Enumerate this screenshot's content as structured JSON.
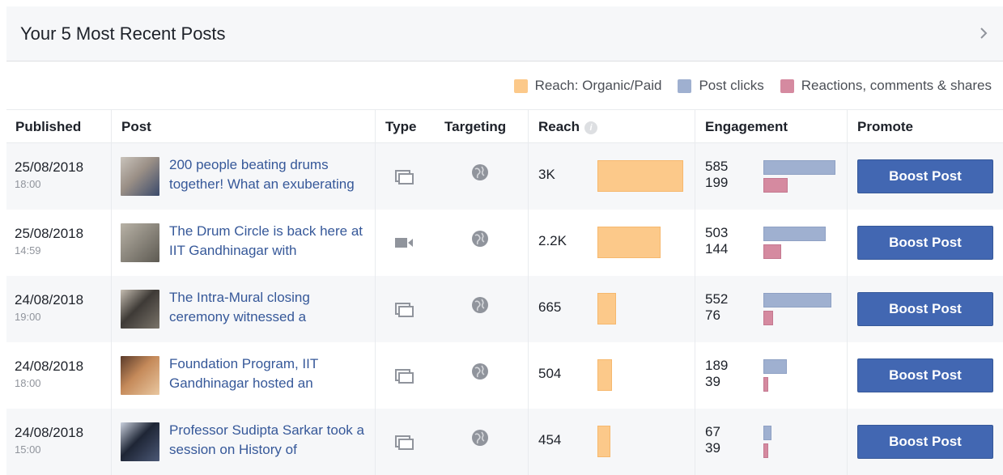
{
  "header": {
    "title": "Your 5 Most Recent Posts"
  },
  "legend": [
    {
      "label": "Reach: Organic/Paid",
      "color": "#fcc98a"
    },
    {
      "label": "Post clicks",
      "color": "#9fb0d0"
    },
    {
      "label": "Reactions, comments & shares",
      "color": "#d58aa0"
    }
  ],
  "columns": {
    "published": "Published",
    "post": "Post",
    "type": "Type",
    "targeting": "Targeting",
    "reach": "Reach",
    "engagement": "Engagement",
    "promote": "Promote"
  },
  "reach_max": 3000,
  "engagement_max": 585,
  "rows": [
    {
      "date": "25/08/2018",
      "time": "18:00",
      "text": "200 people beating drums together! What an exuberating",
      "type": "album",
      "reach_label": "3K",
      "reach_value": 3000,
      "clicks": "585",
      "reactions": "199",
      "clicks_value": 585,
      "reactions_value": 199,
      "boost": "Boost Post"
    },
    {
      "date": "25/08/2018",
      "time": "14:59",
      "text": "The Drum Circle is back here at IIT Gandhinagar with",
      "type": "video",
      "reach_label": "2.2K",
      "reach_value": 2200,
      "clicks": "503",
      "reactions": "144",
      "clicks_value": 503,
      "reactions_value": 144,
      "boost": "Boost Post"
    },
    {
      "date": "24/08/2018",
      "time": "19:00",
      "text": "The Intra-Mural closing ceremony witnessed a",
      "type": "album",
      "reach_label": "665",
      "reach_value": 665,
      "clicks": "552",
      "reactions": "76",
      "clicks_value": 552,
      "reactions_value": 76,
      "boost": "Boost Post"
    },
    {
      "date": "24/08/2018",
      "time": "18:00",
      "text": "Foundation Program, IIT Gandhinagar hosted an",
      "type": "album",
      "reach_label": "504",
      "reach_value": 504,
      "clicks": "189",
      "reactions": "39",
      "clicks_value": 189,
      "reactions_value": 39,
      "boost": "Boost Post"
    },
    {
      "date": "24/08/2018",
      "time": "15:00",
      "text": "Professor Sudipta Sarkar took a session on History of",
      "type": "album",
      "reach_label": "454",
      "reach_value": 454,
      "clicks": "67",
      "reactions": "39",
      "clicks_value": 67,
      "reactions_value": 39,
      "boost": "Boost Post"
    }
  ]
}
